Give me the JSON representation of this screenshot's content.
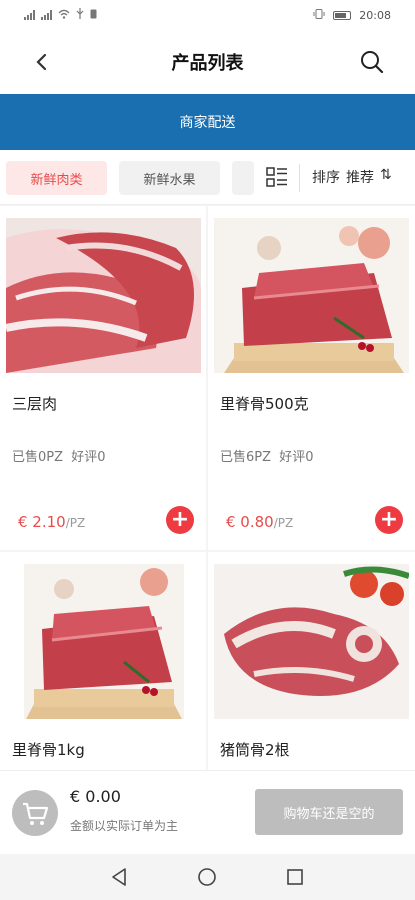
{
  "status_bar": {
    "time": "20:08"
  },
  "header": {
    "title": "产品列表"
  },
  "banner": {
    "label": "商家配送"
  },
  "categories": [
    {
      "label": "新鲜肉类",
      "active": true
    },
    {
      "label": "新鲜水果",
      "active": false
    }
  ],
  "sort": {
    "label": "排序",
    "value": "推荐"
  },
  "products": [
    {
      "name": "三层肉",
      "sold": "已售0PZ",
      "rating": "好评0",
      "price": "€ 2.10",
      "unit": "/PZ"
    },
    {
      "name": "里脊骨500克",
      "sold": "已售6PZ",
      "rating": "好评0",
      "price": "€ 0.80",
      "unit": "/PZ"
    },
    {
      "name": "里脊骨1kg"
    },
    {
      "name": "猪筒骨2根"
    }
  ],
  "cart": {
    "total": "€ 0.00",
    "note": "金额以实际订单为主",
    "checkout_label": "购物车还是空的"
  },
  "colors": {
    "accent": "#e84b4b",
    "banner": "#1a6fb0"
  }
}
